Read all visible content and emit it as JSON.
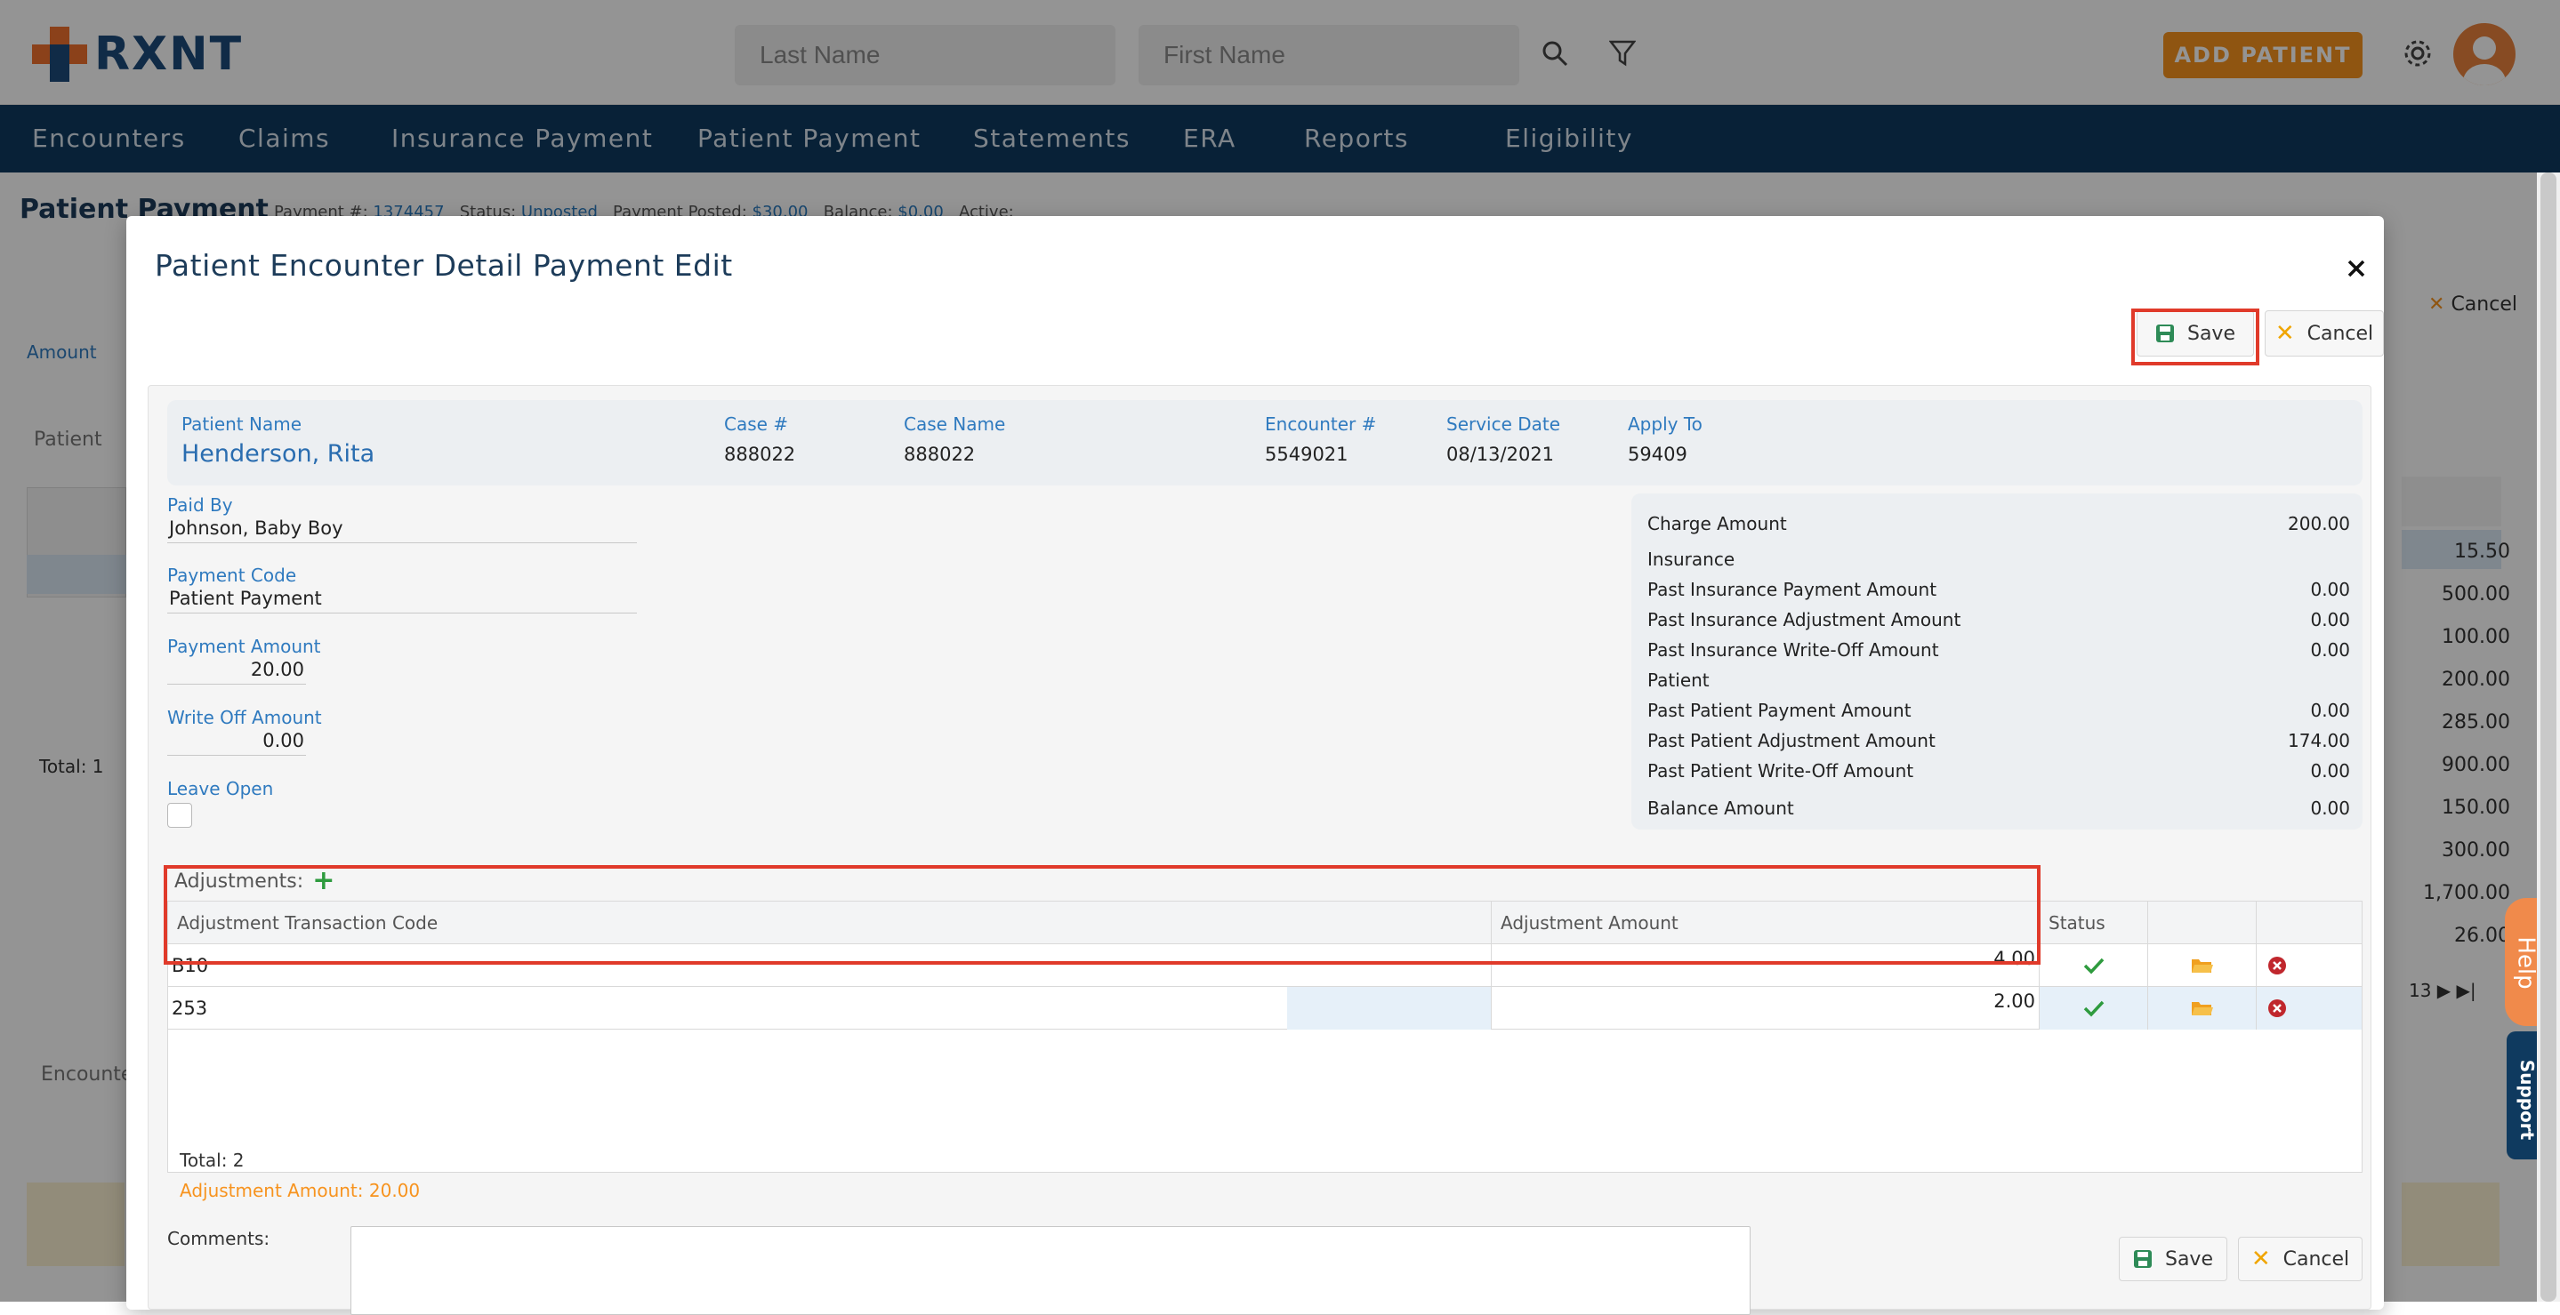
{
  "app": {
    "logo_text": "RXNT"
  },
  "header": {
    "last_name_placeholder": "Last Name",
    "first_name_placeholder": "First Name",
    "add_patient_label": "ADD PATIENT"
  },
  "nav": {
    "items": [
      "Encounters",
      "Claims",
      "Insurance Payment",
      "Patient Payment",
      "Statements",
      "ERA",
      "Reports",
      "Eligibility"
    ]
  },
  "background": {
    "title": "Patient Payment",
    "payment_number_label": "Payment #:",
    "payment_number": "1374457",
    "status_label": "Status:",
    "status": "Unposted",
    "payment_posted_label": "Payment Posted:",
    "payment_posted": "$30.00",
    "balance_label": "Balance:",
    "balance": "$0.00",
    "active_label": "Active:",
    "amount_label": "Amount",
    "patient_label": "Patient",
    "total_label": "Total: 1",
    "encounter_label": "Encounter",
    "cancel_label": "Cancel",
    "pager_text": "13",
    "right_values": [
      "15.50",
      "500.00",
      "100.00",
      "200.00",
      "285.00",
      "900.00",
      "150.00",
      "300.00",
      "1,700.00",
      "26.00"
    ]
  },
  "modal": {
    "title": "Patient Encounter Detail Payment Edit",
    "save_label": "Save",
    "cancel_label": "Cancel",
    "info": {
      "patient_name_label": "Patient Name",
      "patient_name": "Henderson, Rita",
      "case_no_label": "Case #",
      "case_no": "888022",
      "case_name_label": "Case Name",
      "case_name": "888022",
      "encounter_no_label": "Encounter #",
      "encounter_no": "5549021",
      "service_date_label": "Service Date",
      "service_date": "08/13/2021",
      "apply_to_label": "Apply To",
      "apply_to": "59409"
    },
    "form": {
      "paid_by_label": "Paid By",
      "paid_by": "Johnson, Baby Boy",
      "payment_code_label": "Payment Code",
      "payment_code": "Patient Payment",
      "payment_amount_label": "Payment Amount",
      "payment_amount": "20.00",
      "write_off_label": "Write Off Amount",
      "write_off": "0.00",
      "leave_open_label": "Leave Open"
    },
    "summary": {
      "charge_amount_label": "Charge Amount",
      "charge_amount": "200.00",
      "insurance_label": "Insurance",
      "past_ins_payment_label": "Past Insurance Payment Amount",
      "past_ins_payment": "0.00",
      "past_ins_adjustment_label": "Past Insurance Adjustment Amount",
      "past_ins_adjustment": "0.00",
      "past_ins_writeoff_label": "Past Insurance Write-Off Amount",
      "past_ins_writeoff": "0.00",
      "patient_label": "Patient",
      "past_pat_payment_label": "Past Patient Payment Amount",
      "past_pat_payment": "0.00",
      "past_pat_adjustment_label": "Past Patient Adjustment Amount",
      "past_pat_adjustment": "174.00",
      "past_pat_writeoff_label": "Past Patient Write-Off Amount",
      "past_pat_writeoff": "0.00",
      "balance_label": "Balance Amount",
      "balance": "0.00"
    },
    "adjustments": {
      "header": "Adjustments:",
      "columns": [
        "Adjustment Transaction Code",
        "Adjustment Amount",
        "Status"
      ],
      "rows": [
        {
          "code": "B10",
          "amount": "4.00"
        },
        {
          "code": "253",
          "amount": "2.00"
        }
      ],
      "total": "Total: 2",
      "adjustment_amount": "Adjustment Amount: 20.00"
    },
    "comments_label": "Comments:"
  },
  "widgets": {
    "help_label": "Help",
    "support_label": "Support"
  },
  "colors": {
    "brand_navy": "#0f3a5f",
    "accent_orange": "#f7931e",
    "highlight_red": "#e03a2a",
    "label_blue": "#2f7abf"
  }
}
